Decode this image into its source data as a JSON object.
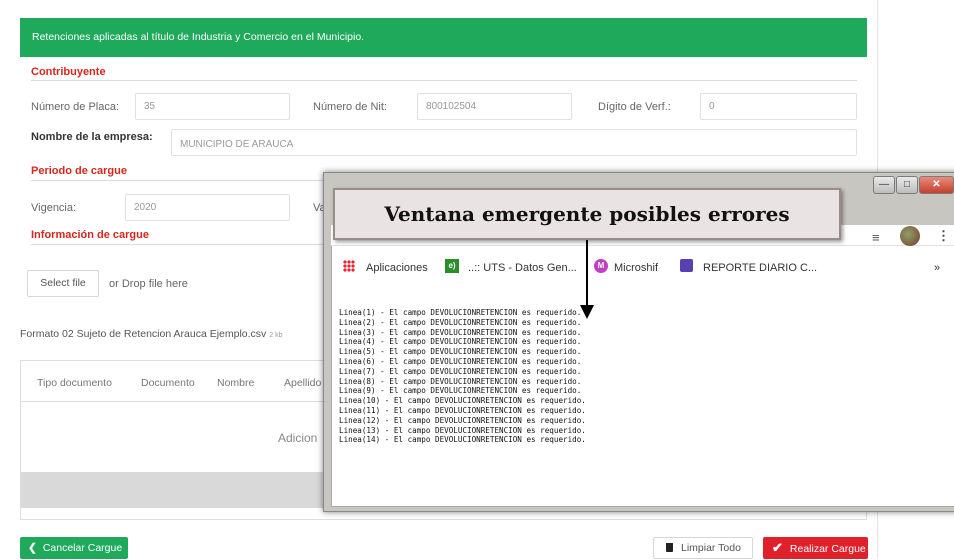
{
  "header": {
    "title": "Retenciones aplicadas al título de Industria y Comercio en el Municipio."
  },
  "contribuyente": {
    "section": "Contribuyente",
    "placa_label": "Número de Placa:",
    "placa_value": "35",
    "nit_label": "Número de Nit:",
    "nit_value": "800102504",
    "digito_label": "Dígito de Verf.:",
    "digito_value": "0",
    "empresa_label": "Nombre de la empresa:",
    "empresa_value": "MUNICIPIO DE ARAUCA"
  },
  "periodo": {
    "section": "Periodo de cargue",
    "vigencia_label": "Vigencia:",
    "vigencia_value": "2020",
    "other_label_partial": "Va"
  },
  "info": {
    "section": "Información de cargue",
    "select_file": "Select file",
    "drop_hint": "or Drop file here",
    "file_name": "Formato 02 Sujeto de Retencion Arauca Ejemplo.csv",
    "file_size": "2 kb"
  },
  "table": {
    "headers": [
      "Tipo documento",
      "Documento",
      "Nombre",
      "Apellido"
    ],
    "empty_text": "Adicion"
  },
  "actions": {
    "cancel": "Cancelar Cargue",
    "clear": "Limpiar Todo",
    "submit": "Realizar Cargue"
  },
  "popup": {
    "caption": "Ventana emergente posibles errores",
    "bookmarks": {
      "apps": "Aplicaciones",
      "uts": "..:: UTS - Datos Gen...",
      "microshif": "Microshif",
      "reporte": "REPORTE DIARIO C...",
      "more": "»"
    },
    "log_lines": [
      "Linea(1) - El campo DEVOLUCIONRETENCION es requerido.",
      "Linea(2) - El campo DEVOLUCIONRETENCION es requerido.",
      "Linea(3) - El campo DEVOLUCIONRETENCION es requerido.",
      "Linea(4) - El campo DEVOLUCIONRETENCION es requerido.",
      "Linea(5) - El campo DEVOLUCIONRETENCION es requerido.",
      "Linea(6) - El campo DEVOLUCIONRETENCION es requerido.",
      "Linea(7) - El campo DEVOLUCIONRETENCION es requerido.",
      "Linea(8) - El campo DEVOLUCIONRETENCION es requerido.",
      "Linea(9) - El campo DEVOLUCIONRETENCION es requerido.",
      "Linea(10) - El campo DEVOLUCIONRETENCION es requerido.",
      "Linea(11) - El campo DEVOLUCIONRETENCION es requerido.",
      "Linea(12) - El campo DEVOLUCIONRETENCION es requerido.",
      "Linea(13) - El campo DEVOLUCIONRETENCION es requerido.",
      "Linea(14) - El campo DEVOLUCIONRETENCION es requerido."
    ]
  },
  "colors": {
    "green": "#1ea95b",
    "red": "#e0202a",
    "section_red": "#d9261c"
  }
}
